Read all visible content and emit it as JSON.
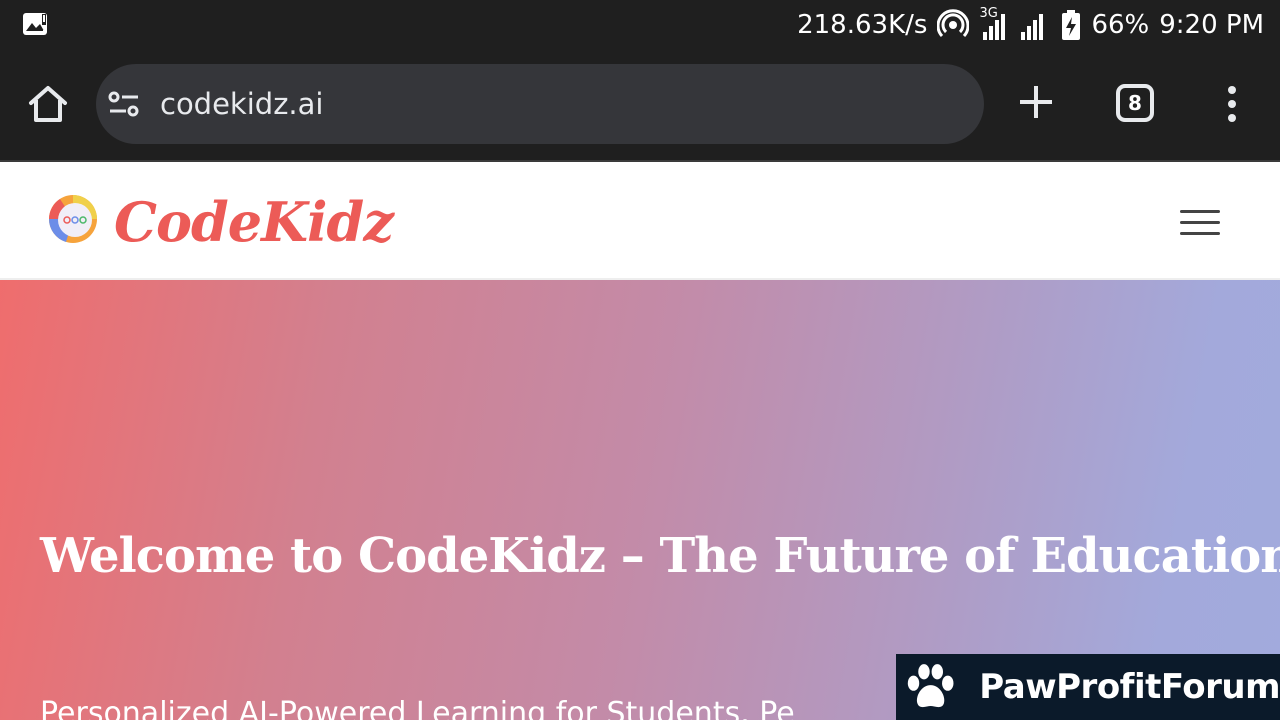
{
  "status_bar": {
    "net_speed": "218.63K/s",
    "network_type": "3G",
    "battery": "66%",
    "time": "9:20 PM",
    "icons": [
      "image-notification-icon",
      "hotspot-icon",
      "signal-icon",
      "battery-charging-icon"
    ]
  },
  "browser": {
    "url": "codekidz.ai",
    "tab_count": "8",
    "icons": [
      "home-icon",
      "tune-icon",
      "plus-icon",
      "tabs-icon",
      "more-vert-icon"
    ]
  },
  "site": {
    "logo_text": "CodeKidz",
    "menu_icon": "hamburger-icon"
  },
  "hero": {
    "title": "Welcome to CodeKidz – The Future of Education",
    "subtitle": "Personalized AI-Powered Learning for Students. Pe"
  },
  "watermark": {
    "text": "PawProfitForum",
    "icon": "paw-icon"
  },
  "colors": {
    "chrome_bg": "#1f1f1f",
    "url_bar_bg": "#35363a",
    "brand": "#ec5b57",
    "hero_gradient_start": "#ef6d6d",
    "hero_gradient_end": "#a2aadd",
    "watermark_bg": "#0b1a2a"
  }
}
